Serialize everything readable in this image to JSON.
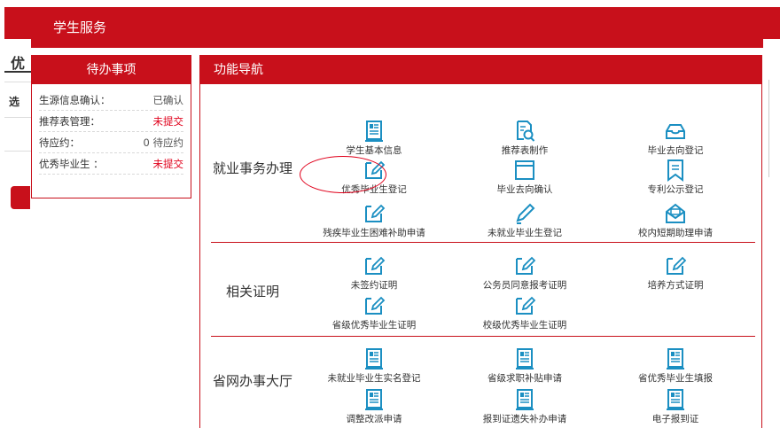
{
  "background": {
    "partial_title": "优",
    "partial_cell": "选"
  },
  "dialog": {
    "title": "学生服务"
  },
  "todo": {
    "title": "待办事项",
    "rows": [
      {
        "label": "生源信息确认：",
        "value": "已确认"
      },
      {
        "label": "推荐表管理：",
        "value": "未提交"
      },
      {
        "label": "待应约：",
        "value": "0 待应约"
      },
      {
        "label": "优秀毕业生 ：",
        "value": "未提交"
      }
    ]
  },
  "nav": {
    "title": "功能导航",
    "sections": [
      {
        "label": "就业事务办理",
        "items": [
          "学生基本信息",
          "推荐表制作",
          "毕业去向登记",
          "优秀毕业生登记",
          "毕业去向确认",
          "专利公示登记",
          "残疾毕业生困难补助申请",
          "未就业毕业生登记",
          "校内短期助理申请"
        ]
      },
      {
        "label": "相关证明",
        "items": [
          "未签约证明",
          "公务员同意报考证明",
          "培养方式证明",
          "省级优秀毕业生证明",
          "校级优秀毕业生证明"
        ]
      },
      {
        "label": "省网办事大厅",
        "items": [
          "未就业毕业生实名登记",
          "省级求职补贴申请",
          "省优秀毕业生填报",
          "调整改派申请",
          "报到证遗失补办申请",
          "电子报到证"
        ]
      }
    ]
  },
  "icon_color": "#1b8fc2",
  "accent_color": "#c8101b"
}
